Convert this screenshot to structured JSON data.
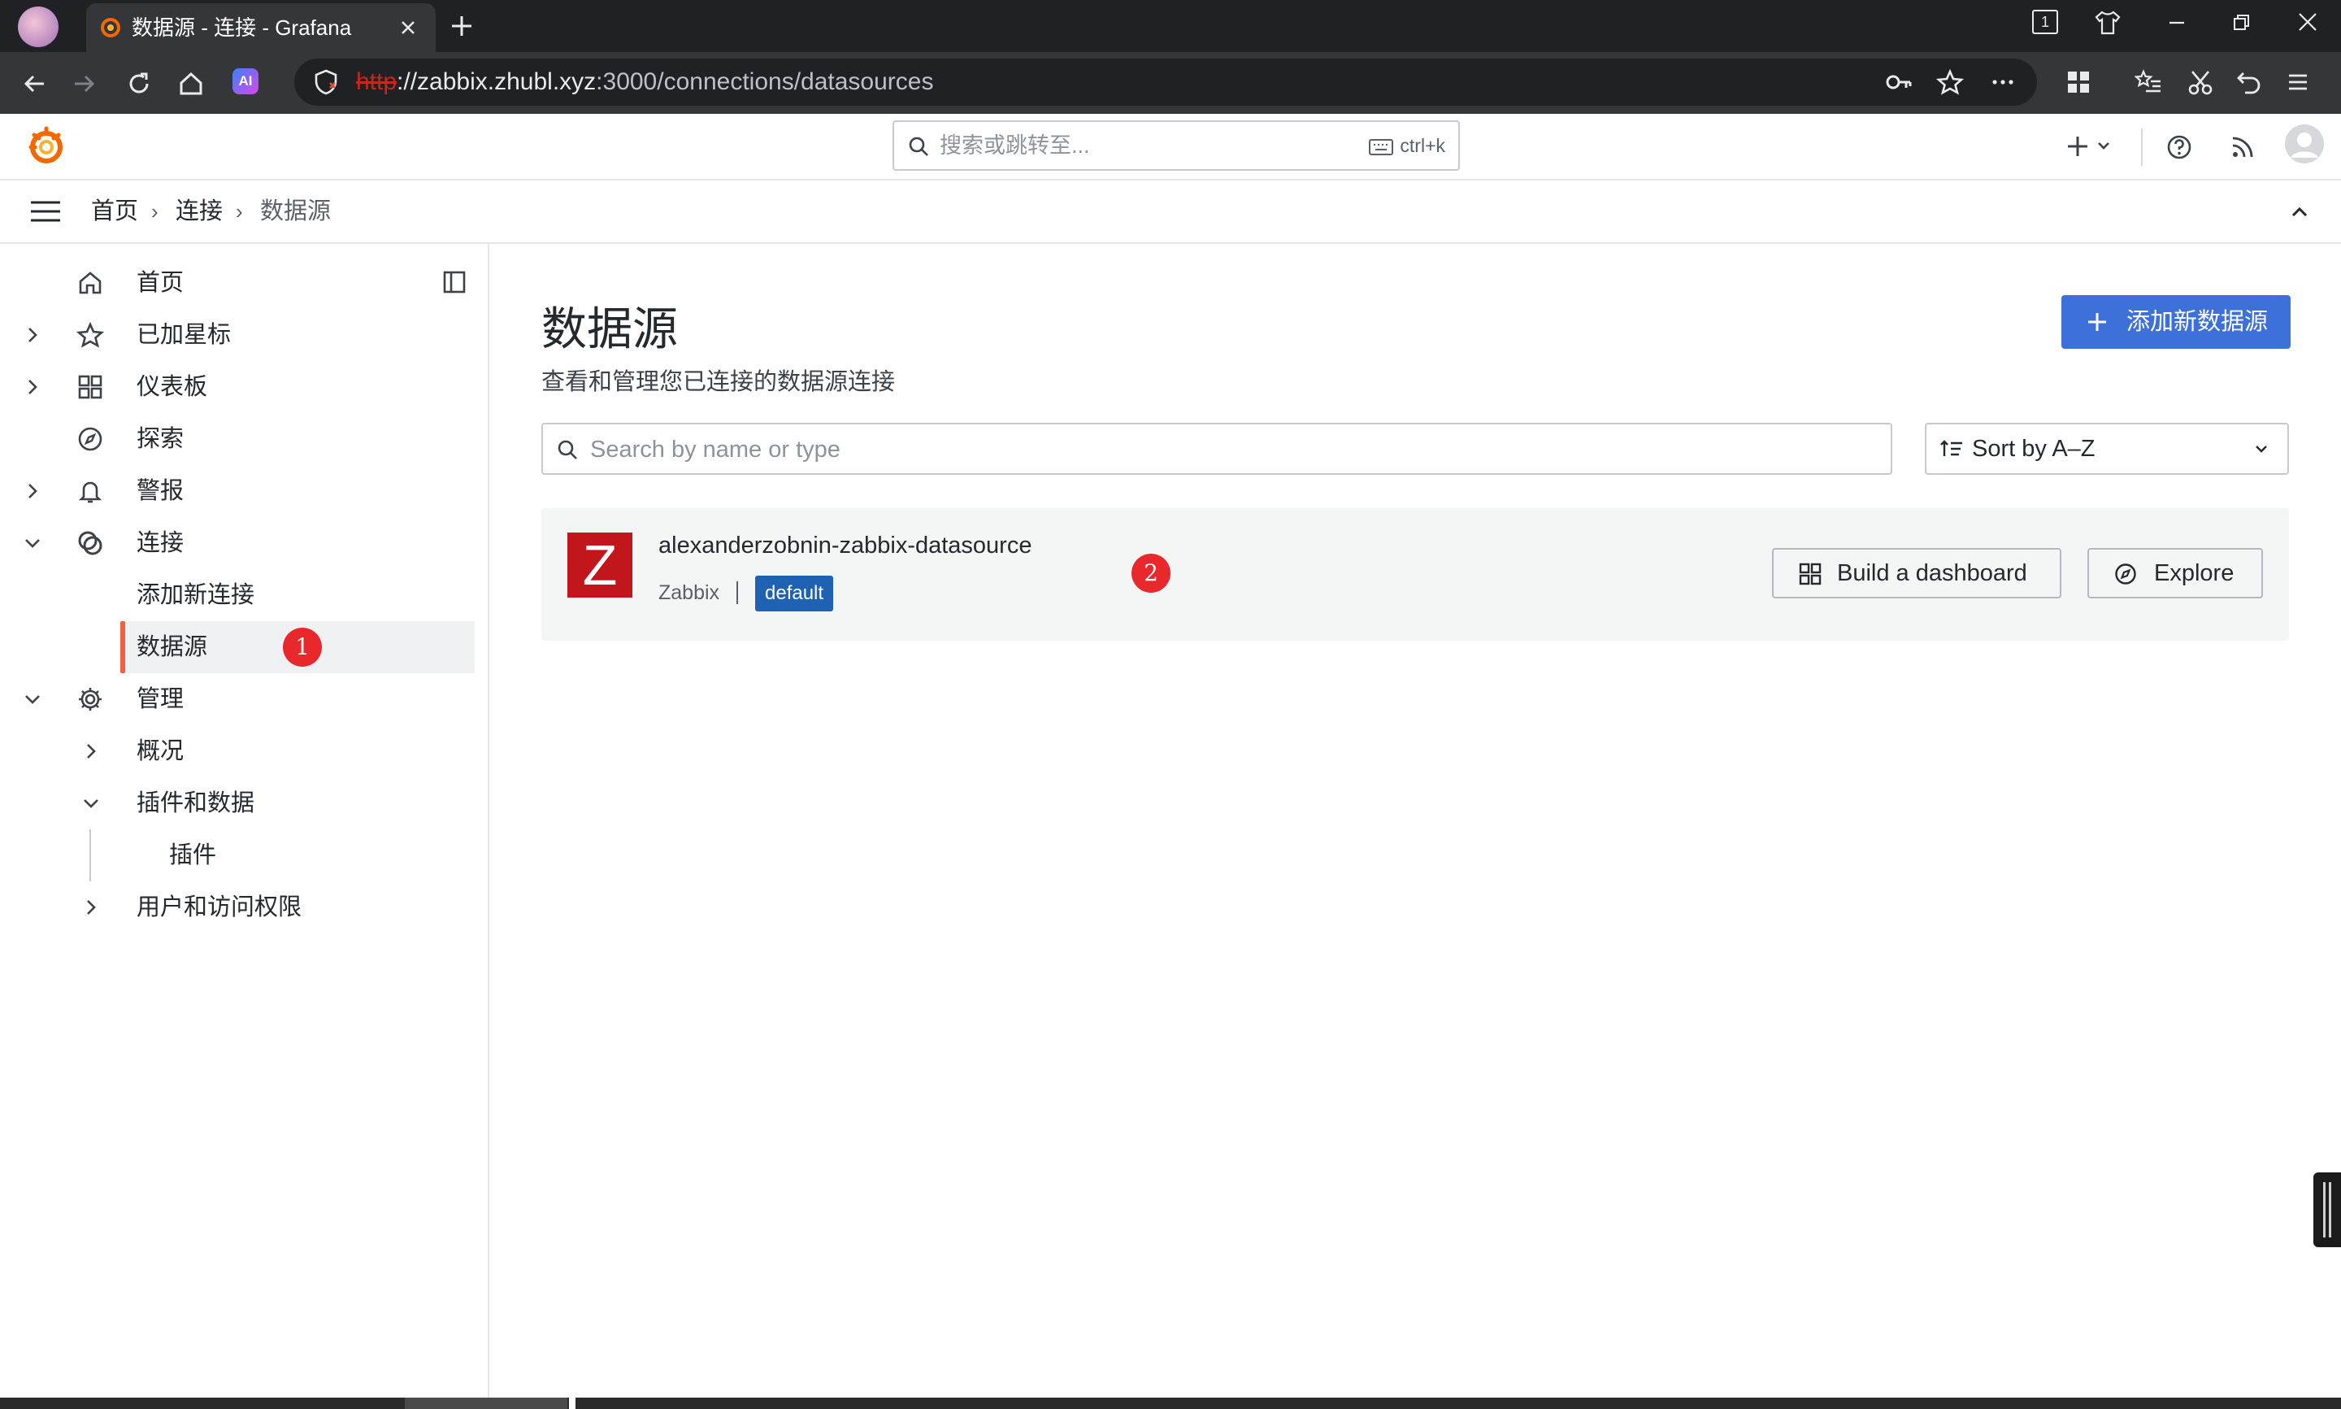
{
  "browser": {
    "tab_title": "数据源 - 连接 - Grafana",
    "tab_count": "1",
    "url_scheme": "http",
    "url_host": "://zabbix.zhubl.xyz",
    "url_path": ":3000/connections/datasources",
    "ai_badge": "AI"
  },
  "topbar": {
    "search_placeholder": "搜索或跳转至...",
    "search_shortcut": "ctrl+k"
  },
  "breadcrumb": {
    "items": [
      "首页",
      "连接",
      "数据源"
    ],
    "separator": "›"
  },
  "sidebar": {
    "items": [
      {
        "label": "首页",
        "icon": "home-icon"
      },
      {
        "label": "已加星标",
        "icon": "star-icon"
      },
      {
        "label": "仪表板",
        "icon": "apps-icon"
      },
      {
        "label": "探索",
        "icon": "compass-icon"
      },
      {
        "label": "警报",
        "icon": "bell-icon"
      },
      {
        "label": "连接",
        "icon": "link-icon"
      },
      {
        "label": "添加新连接"
      },
      {
        "label": "数据源",
        "active": true
      },
      {
        "label": "管理",
        "icon": "gear-icon"
      },
      {
        "label": "概况"
      },
      {
        "label": "插件和数据"
      },
      {
        "label": "插件"
      },
      {
        "label": "用户和访问权限"
      }
    ]
  },
  "annotations": [
    "1",
    "2"
  ],
  "page": {
    "title": "数据源",
    "subtitle": "查看和管理您已连接的数据源连接",
    "add_button": "添加新数据源",
    "search_placeholder": "Search by name or type",
    "sort_label": "Sort by A–Z"
  },
  "datasource": {
    "logo_letter": "Z",
    "name": "alexanderzobnin-zabbix-datasource",
    "type": "Zabbix",
    "badge": "default",
    "build_dashboard": "Build a dashboard",
    "explore": "Explore"
  },
  "colors": {
    "accent": "#3d71d9",
    "active_marker": "#f55f3e",
    "badge_blue": "#1f62b4",
    "annotation_red": "#e8282a",
    "zabbix_red": "#c3161c"
  }
}
